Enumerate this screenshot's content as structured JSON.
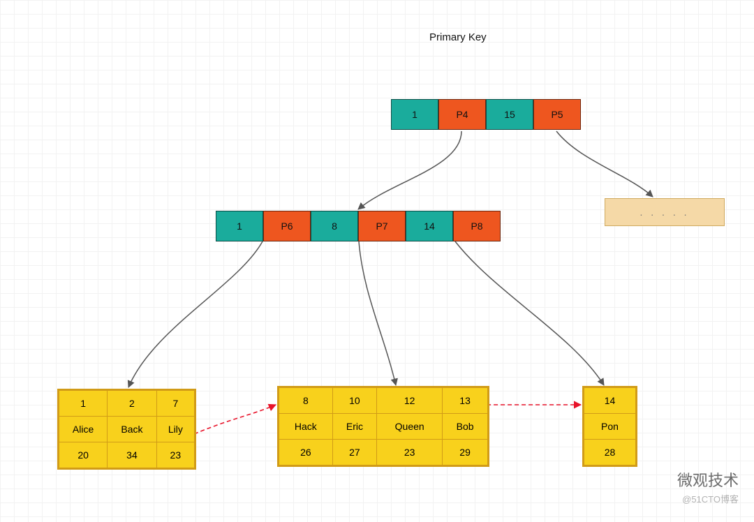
{
  "title": "Primary Key",
  "root": {
    "cells": [
      "1",
      "P4",
      "15",
      "P5"
    ],
    "types": [
      "teal",
      "orange",
      "teal",
      "orange"
    ]
  },
  "mid": {
    "cells": [
      "1",
      "P6",
      "8",
      "P7",
      "14",
      "P8"
    ],
    "types": [
      "teal",
      "orange",
      "teal",
      "orange",
      "teal",
      "orange"
    ]
  },
  "ellipsis": ". . . . .",
  "leaf1": {
    "cols": 3,
    "rows": [
      [
        "1",
        "2",
        "7"
      ],
      [
        "Alice",
        "Back",
        "Lily"
      ],
      [
        "20",
        "34",
        "23"
      ]
    ]
  },
  "leaf2": {
    "cols": 4,
    "rows": [
      [
        "8",
        "10",
        "12",
        "13"
      ],
      [
        "Hack",
        "Eric",
        "Queen",
        "Bob"
      ],
      [
        "26",
        "27",
        "23",
        "29"
      ]
    ]
  },
  "leaf3": {
    "cols": 1,
    "rows": [
      [
        "14"
      ],
      [
        "Pon"
      ],
      [
        "28"
      ]
    ]
  },
  "watermark": {
    "line1": "微观技术",
    "line2": "@51CTO博客"
  },
  "chart_data": {
    "type": "diagram",
    "subtype": "b+tree-index",
    "title": "Primary Key",
    "levels": [
      {
        "level": 0,
        "nodes": [
          {
            "keys": [
              1,
              15
            ],
            "pointers": [
              "P4",
              "P5"
            ]
          }
        ]
      },
      {
        "level": 1,
        "nodes": [
          {
            "keys": [
              1,
              8,
              14
            ],
            "pointers": [
              "P6",
              "P7",
              "P8"
            ]
          },
          {
            "placeholder": true
          }
        ]
      },
      {
        "level": 2,
        "leaves": [
          {
            "id": [
              1,
              2,
              7
            ],
            "name": [
              "Alice",
              "Back",
              "Lily"
            ],
            "age": [
              20,
              34,
              23
            ]
          },
          {
            "id": [
              8,
              10,
              12,
              13
            ],
            "name": [
              "Hack",
              "Eric",
              "Queen",
              "Bob"
            ],
            "age": [
              26,
              27,
              23,
              29
            ]
          },
          {
            "id": [
              14
            ],
            "name": [
              "Pon"
            ],
            "age": [
              28
            ]
          }
        ]
      }
    ],
    "edges_solid": [
      [
        "root.P4",
        "mid"
      ],
      [
        "root.P5",
        "ellipsis"
      ],
      [
        "mid.P6",
        "leaf1"
      ],
      [
        "mid.P7",
        "leaf2"
      ],
      [
        "mid.P8",
        "leaf3"
      ]
    ],
    "edges_dashed": [
      [
        "leaf1",
        "leaf2"
      ],
      [
        "leaf2",
        "leaf3"
      ]
    ]
  }
}
